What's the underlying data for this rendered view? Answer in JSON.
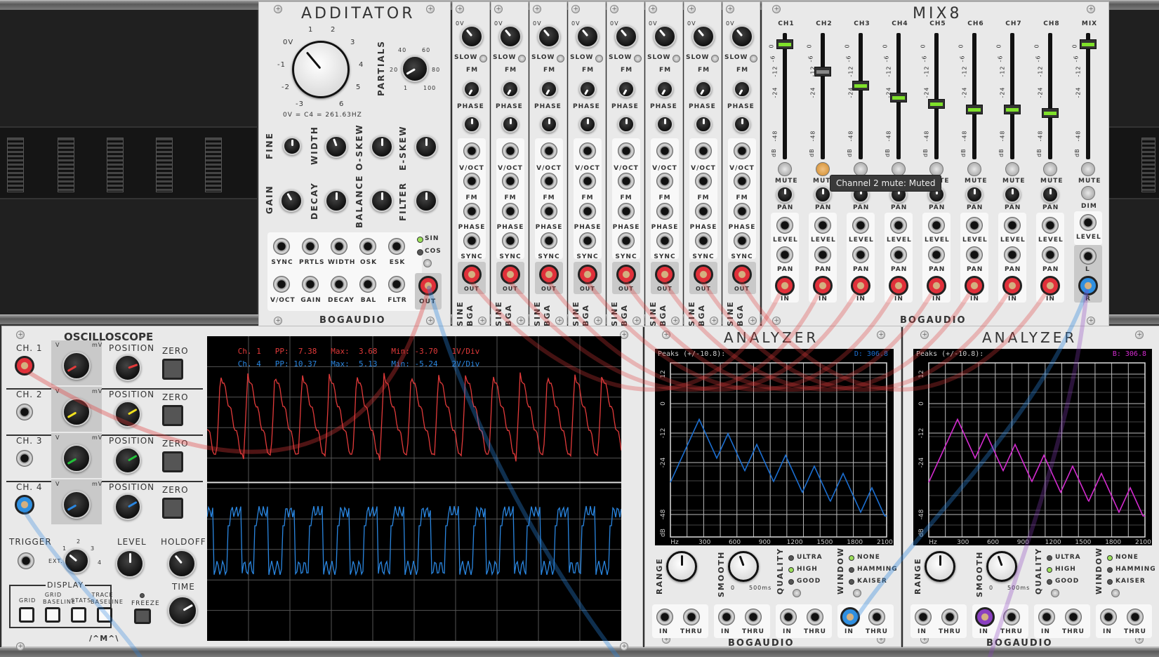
{
  "additator": {
    "title": "ADDITATOR",
    "freq_note": "0V = C4 = 261.63HZ",
    "freq_scale": [
      "0V",
      "-1",
      "-2",
      "-3",
      "1",
      "2",
      "3",
      "4",
      "5",
      "6"
    ],
    "partials_label": "PARTIALS",
    "partials_scale": [
      "40",
      "60",
      "20",
      "80",
      "1",
      "100"
    ],
    "knob_labels": [
      "FINE",
      "WIDTH",
      "O-SKEW",
      "E-SKEW",
      "GAIN",
      "DECAY",
      "BALANCE",
      "FILTER"
    ],
    "jack_labels_row1": [
      "SYNC",
      "PRTLS",
      "WIDTH",
      "OSK",
      "ESK"
    ],
    "jack_labels_row2": [
      "V/OCT",
      "GAIN",
      "DECAY",
      "BAL",
      "FLTR"
    ],
    "wave_options": [
      "SIN",
      "COS"
    ],
    "out_label": "OUT",
    "brand": "BOGAUDIO"
  },
  "sines": {
    "count": 8,
    "labels": {
      "zero": "0V",
      "slow": "SLOW",
      "fm": "FM",
      "phase": "PHASE",
      "voct": "V/OCT",
      "sync": "SYNC",
      "out": "OUT",
      "name": "SINE",
      "brand": "BGA"
    }
  },
  "mix8": {
    "title": "MIX8",
    "channels": [
      "CH1",
      "CH2",
      "CH3",
      "CH4",
      "CH5",
      "CH6",
      "CH7",
      "CH8",
      "MIX"
    ],
    "scale": [
      "0",
      "-6",
      "-12",
      "-24",
      "-48",
      "dB"
    ],
    "mute_label": "MUTE",
    "pan_label": "PAN",
    "level_label": "LEVEL",
    "in_label": "IN",
    "dim_label": "DIM",
    "l_label": "L",
    "r_label": "R",
    "brand": "BOGAUDIO",
    "fader_levels": [
      0.95,
      0.72,
      0.6,
      0.5,
      0.45,
      0.4,
      0.4,
      0.37,
      0.95
    ],
    "tooltip": "Channel 2 mute: Muted"
  },
  "scope": {
    "title": "OSCILLOSCOPE",
    "channels": [
      "CH. 1",
      "CH. 2",
      "CH. 3",
      "CH. 4"
    ],
    "position_label": "POSITION",
    "zero_label": "ZERO",
    "scale_labels": [
      "V",
      "mV",
      "50",
      "20",
      "10",
      "5",
      "2",
      "1",
      ".5",
      ".2",
      ".1"
    ],
    "trigger_label": "TRIGGER",
    "ext_label": "EXT.",
    "level_label": "LEVEL",
    "holdoff_label": "HOLDOFF",
    "display_label": "DISPLAY",
    "display_opts": [
      "GRID",
      "GRID BASELINE",
      "STATS",
      "TRACE BASELINE"
    ],
    "freeze_label": "FREEZE",
    "time_label": "TIME",
    "trigger_scale": [
      "1",
      "2",
      "3",
      "4"
    ],
    "logo": "/^M^\\",
    "stats": [
      {
        "ch": "Ch. 1",
        "pp": "PP:  7.38",
        "max": "Max:  3.68",
        "min": "Min: -3.70",
        "div": "1V/Div"
      },
      {
        "ch": "Ch. 4",
        "pp": "PP: 10.37",
        "max": "Max:  5.13",
        "min": "Min: -5.24",
        "div": "2V/Div"
      }
    ]
  },
  "analyzers": [
    {
      "title": "ANALYZER",
      "peaks": "Peaks (+/-10.8):",
      "peak_id": "D:  306.8",
      "color": "#1c6fd1",
      "y_ticks": [
        "12",
        "0",
        "-12",
        "-24",
        "-48",
        "dB"
      ],
      "x_ticks": [
        "Hz",
        "300",
        "600",
        "900",
        "1200",
        "1500",
        "1800",
        "2100"
      ],
      "range_label": "RANGE",
      "smooth_label": "SMOOTH",
      "quality_label": "QUALITY",
      "window_label": "WINDOW",
      "quality_opts": [
        "ULTRA",
        "HIGH",
        "GOOD"
      ],
      "window_opts": [
        "NONE",
        "HAMMING",
        "KAISER"
      ],
      "smooth_scale": [
        "0",
        "500ms"
      ],
      "in_label": "IN",
      "thru_label": "THRU",
      "brand": "BOGAUDIO"
    },
    {
      "title": "ANALYZER",
      "peaks": "Peaks (+/-10.8):",
      "peak_id": "B:  306.8",
      "color": "#d42bd0",
      "y_ticks": [
        "12",
        "0",
        "-12",
        "-24",
        "-48",
        "dB"
      ],
      "x_ticks": [
        "Hz",
        "300",
        "600",
        "900",
        "1200",
        "1500",
        "1800",
        "2100"
      ],
      "range_label": "RANGE",
      "smooth_label": "SMOOTH",
      "quality_label": "QUALITY",
      "window_label": "WINDOW",
      "quality_opts": [
        "ULTRA",
        "HIGH",
        "GOOD"
      ],
      "window_opts": [
        "NONE",
        "HAMMING",
        "KAISER"
      ],
      "smooth_scale": [
        "0",
        "500ms"
      ],
      "in_label": "IN",
      "thru_label": "THRU",
      "brand": "BOGAUDIO"
    }
  ]
}
